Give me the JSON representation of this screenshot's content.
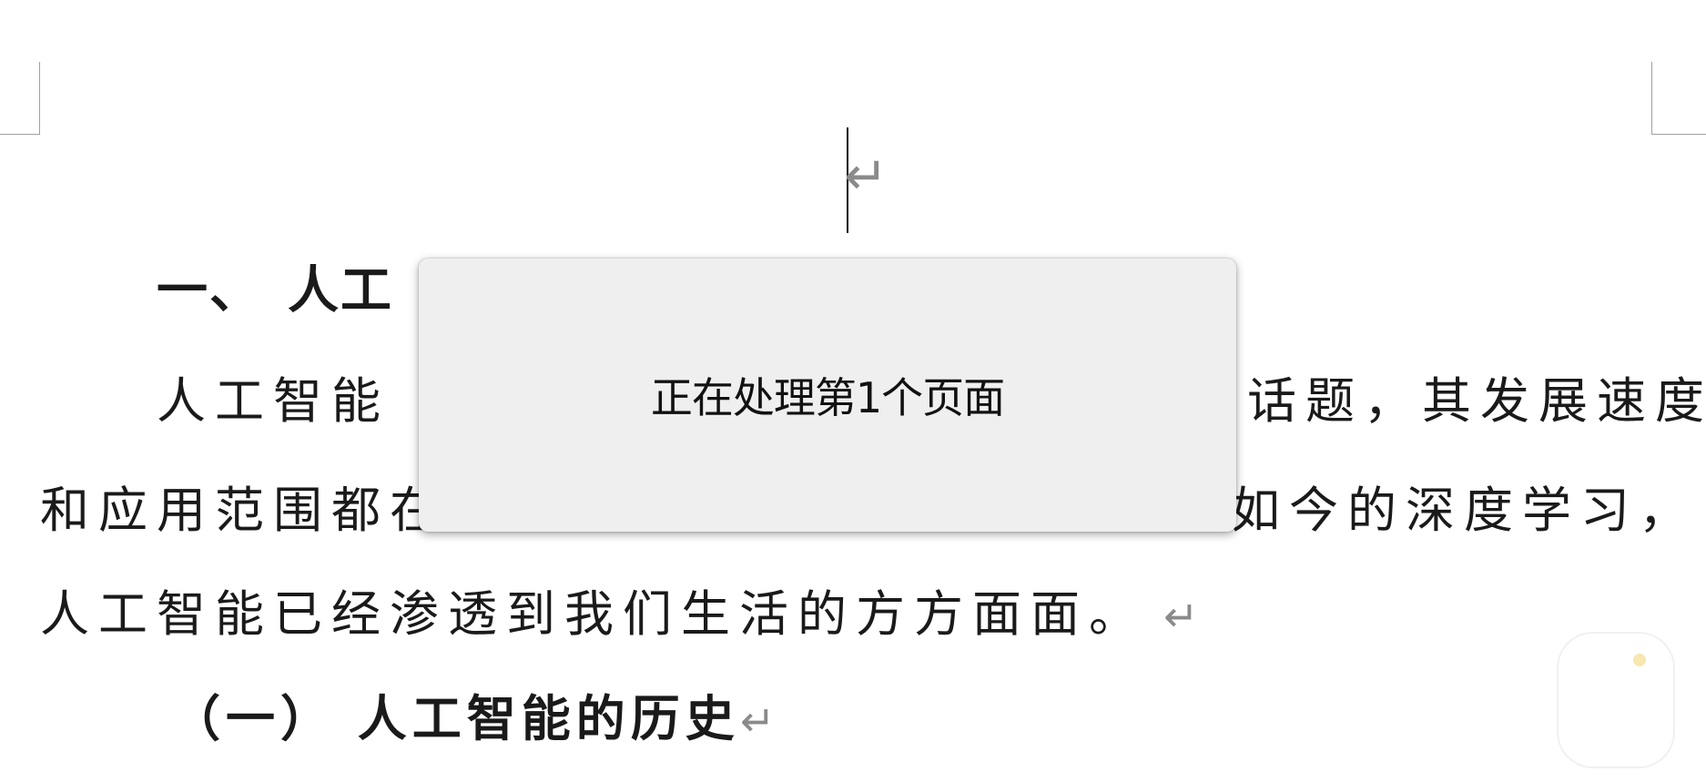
{
  "document": {
    "empty_paragraph_mark": "↵",
    "heading1": {
      "number": "一、",
      "text_visible": "人工"
    },
    "paragraph1": {
      "line1_left": "人工智能（",
      "line1_right": "话题，其发展速度",
      "line2_left": "和应用范围都在",
      "line2_right": "如今的深度学习，",
      "line3": "人工智能已经渗透到我们生活的方方面面。",
      "para_mark": "↵"
    },
    "heading2": {
      "text": "（一） 人工智能的历史",
      "para_mark": "↵"
    }
  },
  "dialog": {
    "message": "正在处理第1个页面"
  }
}
